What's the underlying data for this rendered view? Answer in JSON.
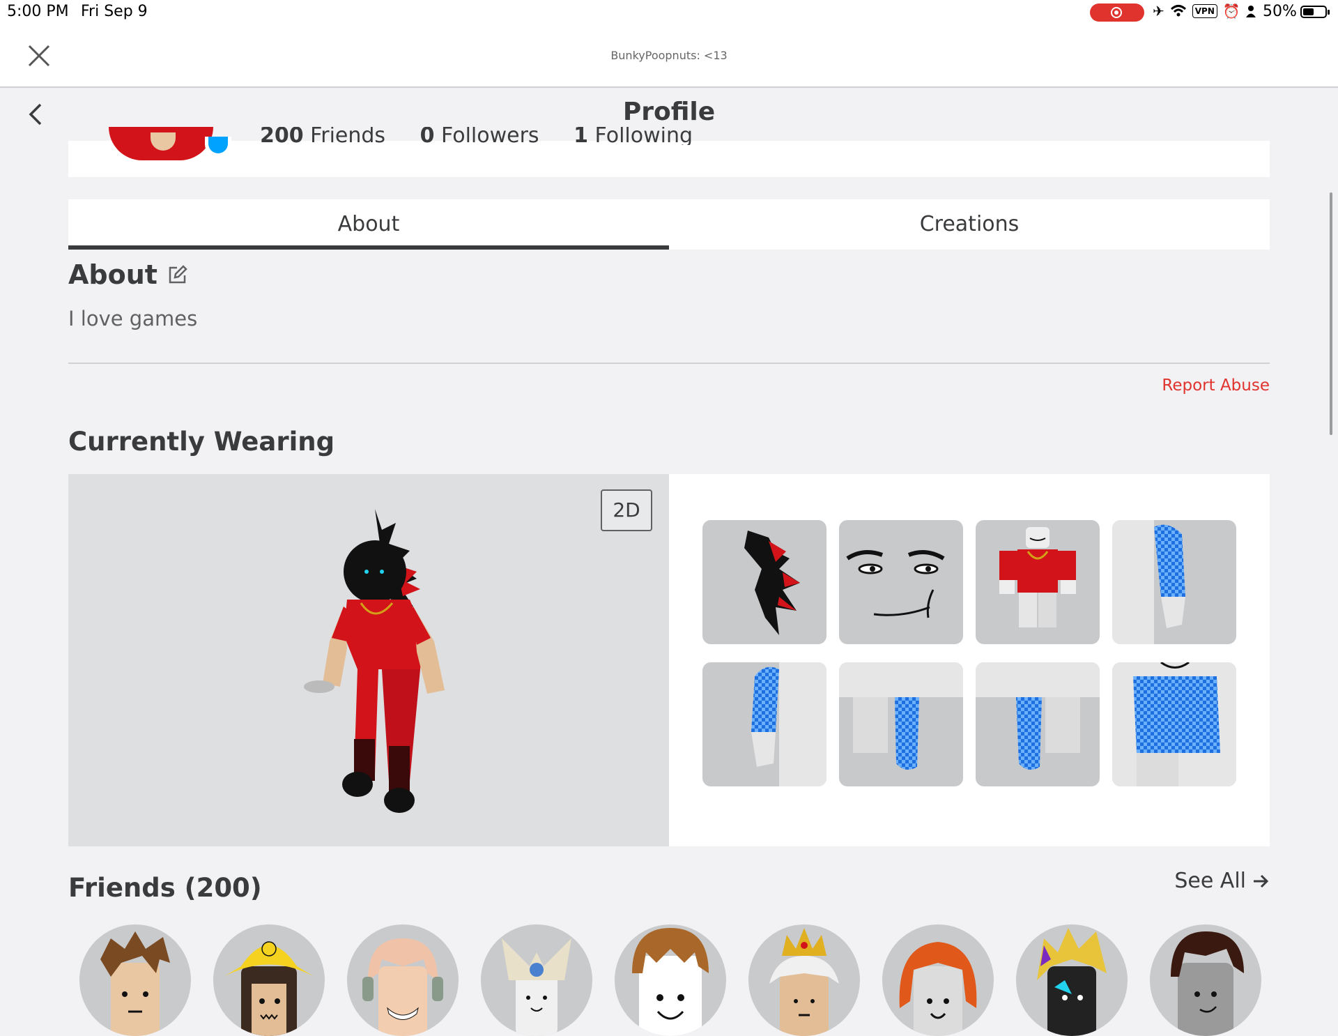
{
  "status_bar": {
    "time": "5:00 PM",
    "date": "Fri Sep 9",
    "vpn_label": "VPN",
    "battery_percent": "50%",
    "battery_level": 0.5,
    "recording_color": "#e0332d"
  },
  "browser": {
    "page_url": "BunkyPoopnuts: <13"
  },
  "header": {
    "title": "Profile"
  },
  "profile_stats": {
    "friends": {
      "count": "200",
      "label": "Friends"
    },
    "followers": {
      "count": "0",
      "label": "Followers"
    },
    "following": {
      "count": "1",
      "label": "Following"
    }
  },
  "tabs": [
    {
      "label": "About",
      "active": true
    },
    {
      "label": "Creations",
      "active": false
    }
  ],
  "about": {
    "title": "About",
    "text": "I love games",
    "report_label": "Report Abuse"
  },
  "currently_wearing": {
    "title": "Currently Wearing",
    "view_toggle_label": "2D",
    "items": [
      {
        "icon": "red-black-hair-icon"
      },
      {
        "icon": "man-face-icon"
      },
      {
        "icon": "red-shirt-icon"
      },
      {
        "icon": "blue-checkered-right-arm-icon"
      },
      {
        "icon": "blue-checkered-left-arm-icon"
      },
      {
        "icon": "blue-checkered-left-leg-icon"
      },
      {
        "icon": "blue-checkered-right-leg-icon"
      },
      {
        "icon": "blue-checkered-torso-icon"
      }
    ]
  },
  "friends": {
    "title": "Friends (200)",
    "see_all_label": "See All",
    "avatars": [
      {
        "icon": "friend-avatar-brown-hair"
      },
      {
        "icon": "friend-avatar-yellow-hat"
      },
      {
        "icon": "friend-avatar-blonde-headphones"
      },
      {
        "icon": "friend-avatar-white-helmet"
      },
      {
        "icon": "friend-avatar-brown-hair-smile"
      },
      {
        "icon": "friend-avatar-crown"
      },
      {
        "icon": "friend-avatar-red-hair"
      },
      {
        "icon": "friend-avatar-gold-hair"
      },
      {
        "icon": "friend-avatar-dark-hair"
      }
    ]
  },
  "colors": {
    "accent_red": "#e0332d",
    "text_dark": "#393b3d",
    "online_blue": "#00a2ff"
  }
}
